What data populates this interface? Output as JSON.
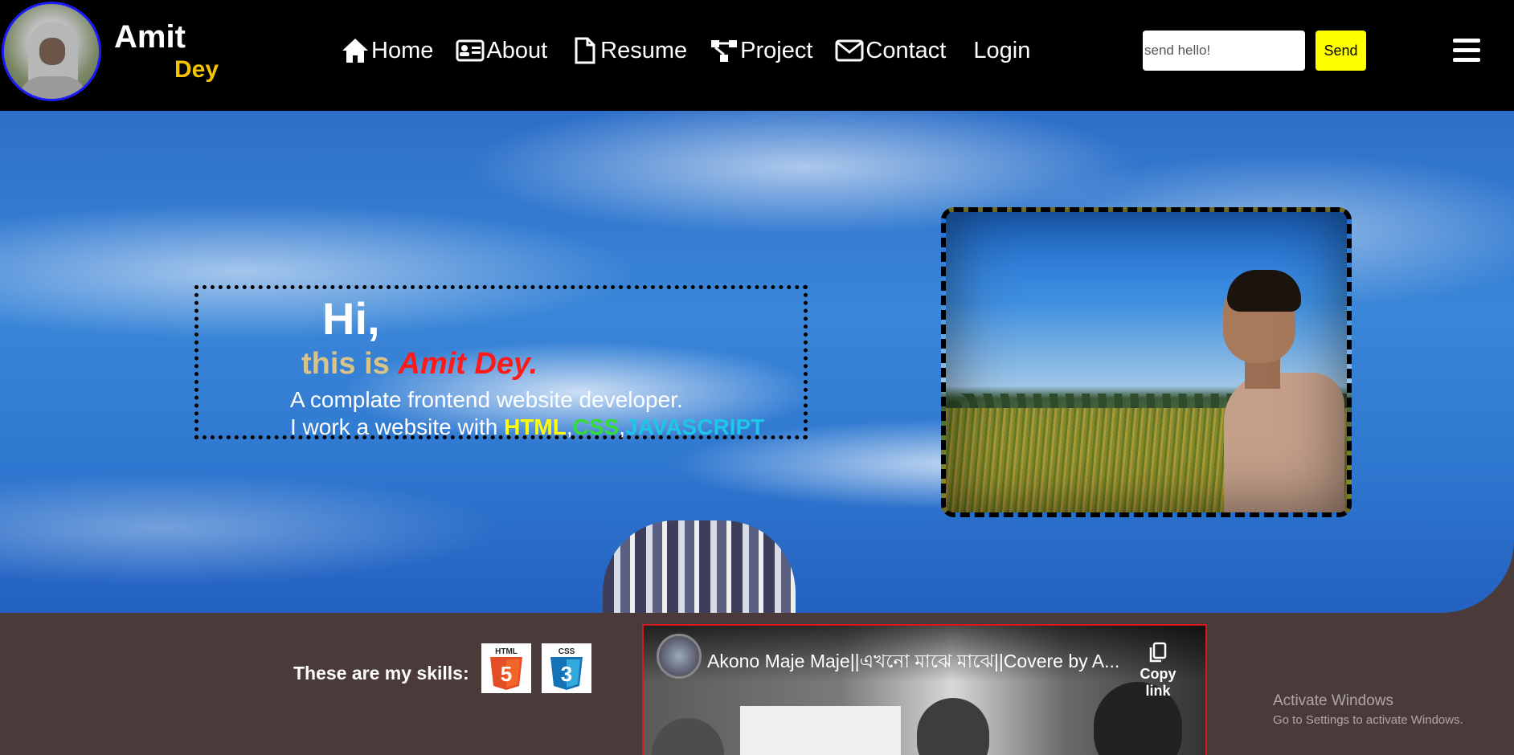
{
  "brand": {
    "first_name": "Amit",
    "last_name": "Dey"
  },
  "nav": {
    "items": [
      {
        "label": "Home",
        "icon": "home-icon"
      },
      {
        "label": "About",
        "icon": "id-card-icon"
      },
      {
        "label": "Resume",
        "icon": "file-icon"
      },
      {
        "label": "Project",
        "icon": "project-icon"
      },
      {
        "label": "Contact",
        "icon": "envelope-icon"
      },
      {
        "label": "Login"
      }
    ],
    "hello_placeholder": "send hello!",
    "send_label": "Send",
    "menu_icon": "hamburger-icon"
  },
  "hero": {
    "greeting": "Hi,",
    "lead": "this is ",
    "name": "Amit Dey.",
    "line1": "A complate frontend website developer.",
    "line2_prefix": "I work a website with ",
    "skill_html": "HTML",
    "sep1": ",",
    "skill_css": "CSS",
    "sep2": ",",
    "skill_js": "JAVASCRIPT"
  },
  "skills": {
    "label": "These are my skills:",
    "badges": [
      {
        "name": "html5-logo",
        "text": "HTML",
        "color": "#e44d26"
      },
      {
        "name": "css3-logo",
        "text": "CSS",
        "color": "#1572b6"
      }
    ]
  },
  "video": {
    "title": "Akono Maje Maje||এখনো মাঝে মাঝে||Covere by A...",
    "copy_label": "Copy link"
  },
  "watermark": {
    "title": "Activate Windows",
    "subtitle": "Go to Settings to activate Windows."
  },
  "colors": {
    "nav_bg": "#000000",
    "brand_accent": "#f5c400",
    "send_button": "#ffff00",
    "name_red": "#ff1a1a",
    "html_yellow": "#ffff00",
    "css_green": "#33dd33",
    "js_cyan": "#1ec6e8",
    "footer_bg": "#4a3a3a"
  }
}
